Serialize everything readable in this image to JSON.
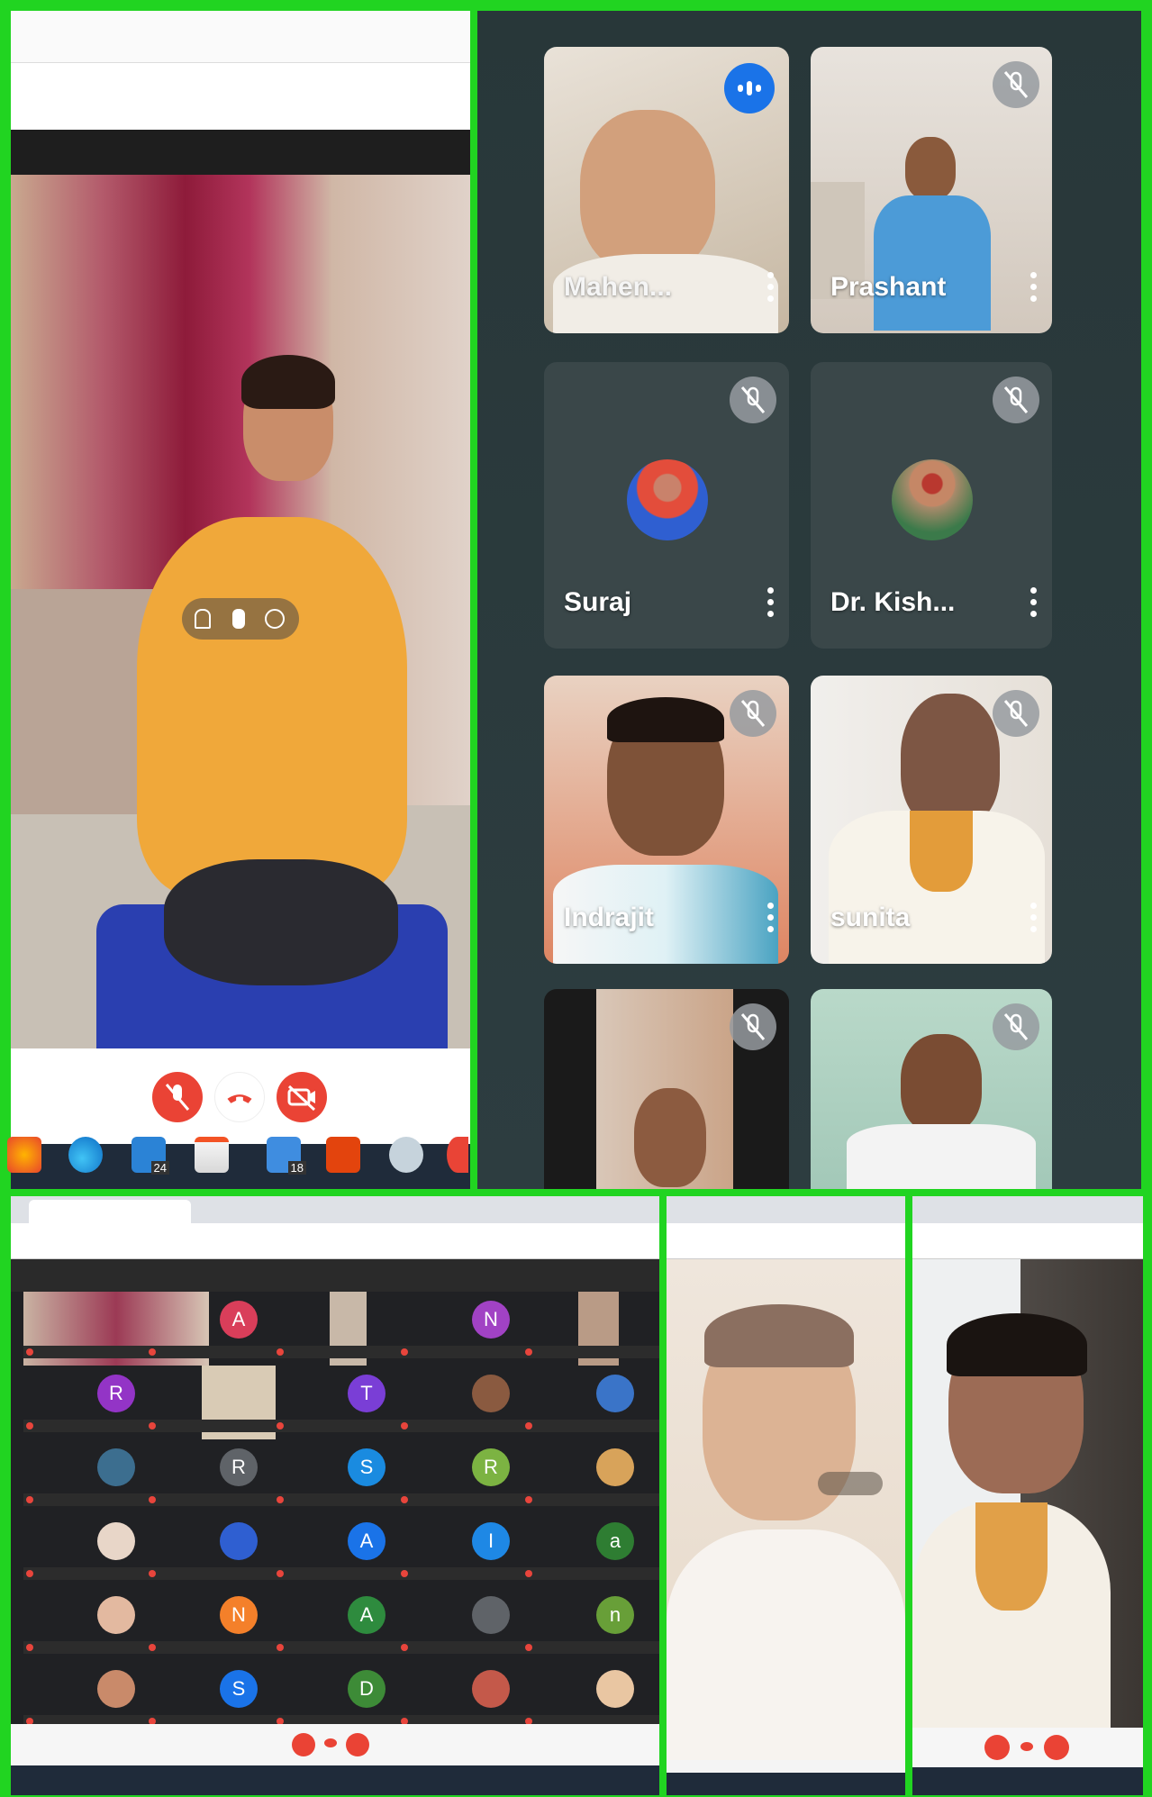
{
  "main_call": {
    "participants": [
      {
        "name": "Mahen..."
      },
      {
        "name": "Prashant"
      },
      {
        "name": "Suraj"
      },
      {
        "name": "Dr. Kish..."
      },
      {
        "name": "Indrajit"
      },
      {
        "name": "sunita"
      },
      {
        "name": ""
      },
      {
        "name": ""
      }
    ]
  },
  "taskbar": {
    "mail_badge": "24",
    "app_badge": "18"
  },
  "grid_view": {
    "avatar_letters": [
      "A",
      "N",
      "R",
      "T",
      "R",
      "S",
      "R",
      "A",
      "I",
      "a",
      "N",
      "A",
      "n",
      "S",
      "D"
    ]
  },
  "colors": {
    "frame_border": "#21d421",
    "meet_bg": "#2b3a3d",
    "tile_bg": "#3a4749",
    "end_call_red": "#ea4335",
    "speaking_blue": "#1a73e8"
  }
}
